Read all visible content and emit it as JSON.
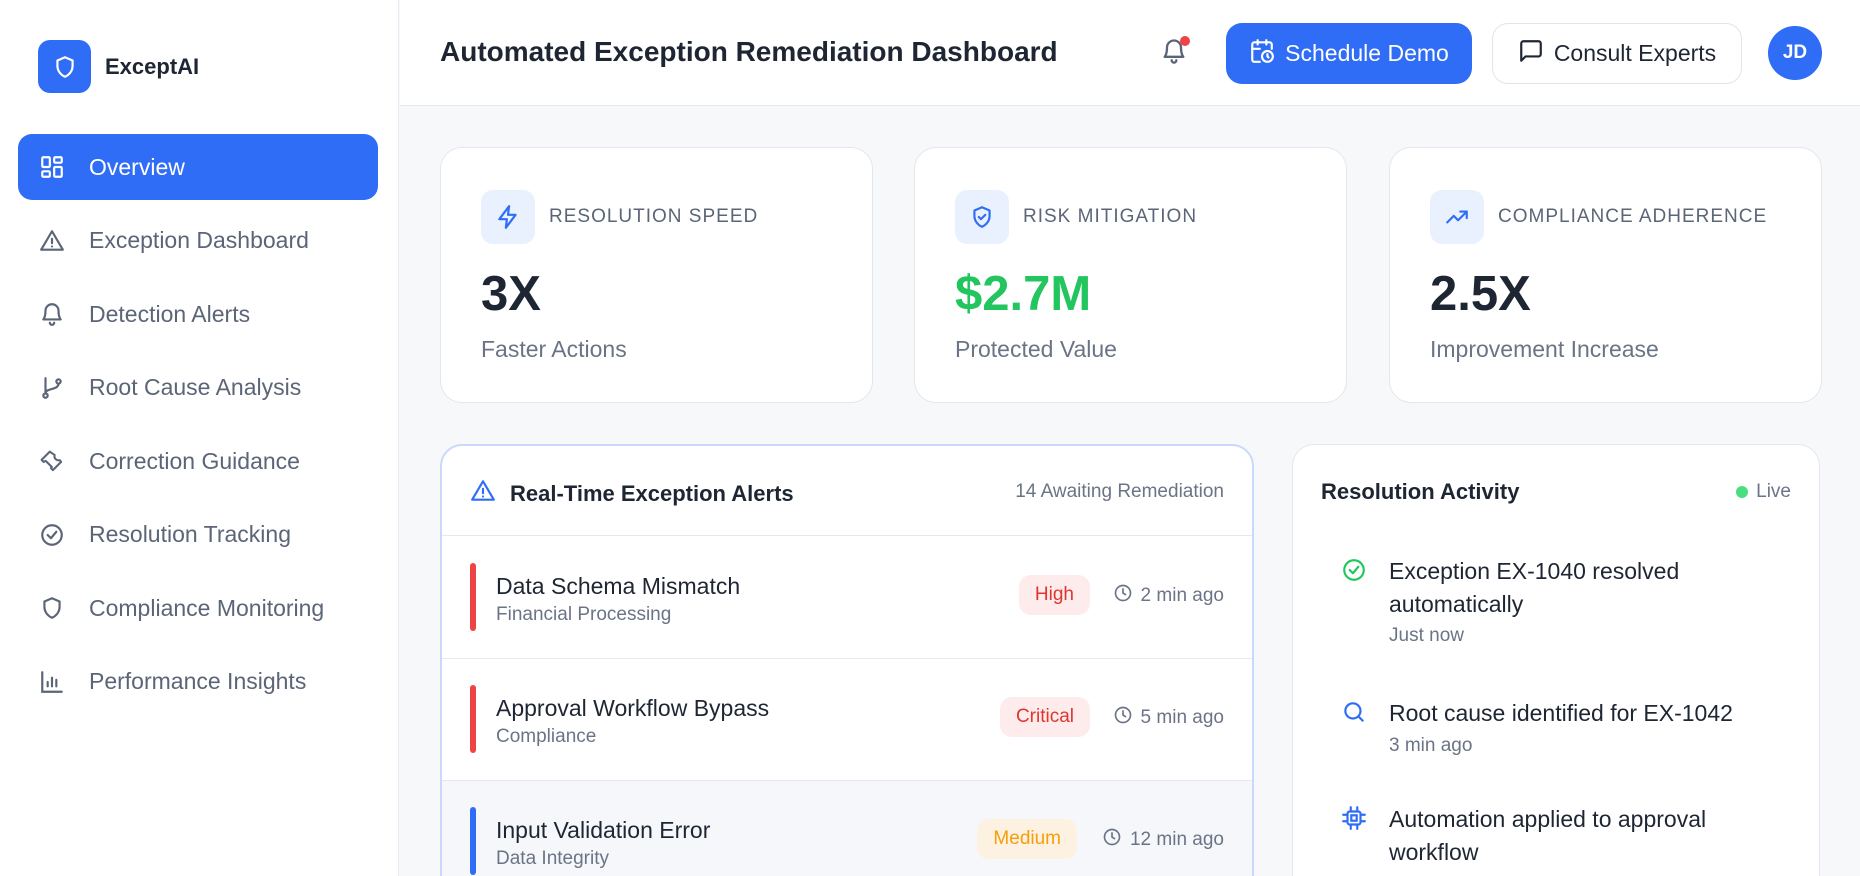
{
  "brand": {
    "name": "ExceptAI"
  },
  "sidebar": {
    "items": [
      {
        "label": "Overview"
      },
      {
        "label": "Exception Dashboard"
      },
      {
        "label": "Detection Alerts"
      },
      {
        "label": "Root Cause Analysis"
      },
      {
        "label": "Correction Guidance"
      },
      {
        "label": "Resolution Tracking"
      },
      {
        "label": "Compliance Monitoring"
      },
      {
        "label": "Performance Insights"
      }
    ]
  },
  "header": {
    "title": "Automated Exception Remediation Dashboard",
    "schedule_label": "Schedule Demo",
    "consult_label": "Consult Experts",
    "avatar_initials": "JD"
  },
  "stats": [
    {
      "label": "RESOLUTION SPEED",
      "value": "3X",
      "sub": "Faster Actions"
    },
    {
      "label": "RISK MITIGATION",
      "value": "$2.7M",
      "sub": "Protected Value"
    },
    {
      "label": "COMPLIANCE ADHERENCE",
      "value": "2.5X",
      "sub": "Improvement Increase"
    }
  ],
  "alerts": {
    "title": "Real-Time Exception Alerts",
    "count": "14 Awaiting Remediation",
    "rows": [
      {
        "name": "Data Schema Mismatch",
        "category": "Financial Processing",
        "severity": "High",
        "time": "2 min ago"
      },
      {
        "name": "Approval Workflow Bypass",
        "category": "Compliance",
        "severity": "Critical",
        "time": "5 min ago"
      },
      {
        "name": "Input Validation Error",
        "category": "Data Integrity",
        "severity": "Medium",
        "time": "12 min ago"
      }
    ]
  },
  "activity": {
    "title": "Resolution Activity",
    "live_label": "Live",
    "items": [
      {
        "text": "Exception EX-1040 resolved automatically",
        "time": "Just now",
        "icon": "check-circle-icon"
      },
      {
        "text": "Root cause identified for EX-1042",
        "time": "3 min ago",
        "icon": "search-icon"
      },
      {
        "text": "Automation applied to approval workflow",
        "time": "",
        "icon": "cpu-icon"
      }
    ]
  },
  "colors": {
    "accent": "#2f6df6",
    "high": "#ef4444",
    "critical": "#ef4444",
    "medium": "#f59e0b",
    "success": "#22c55e"
  }
}
